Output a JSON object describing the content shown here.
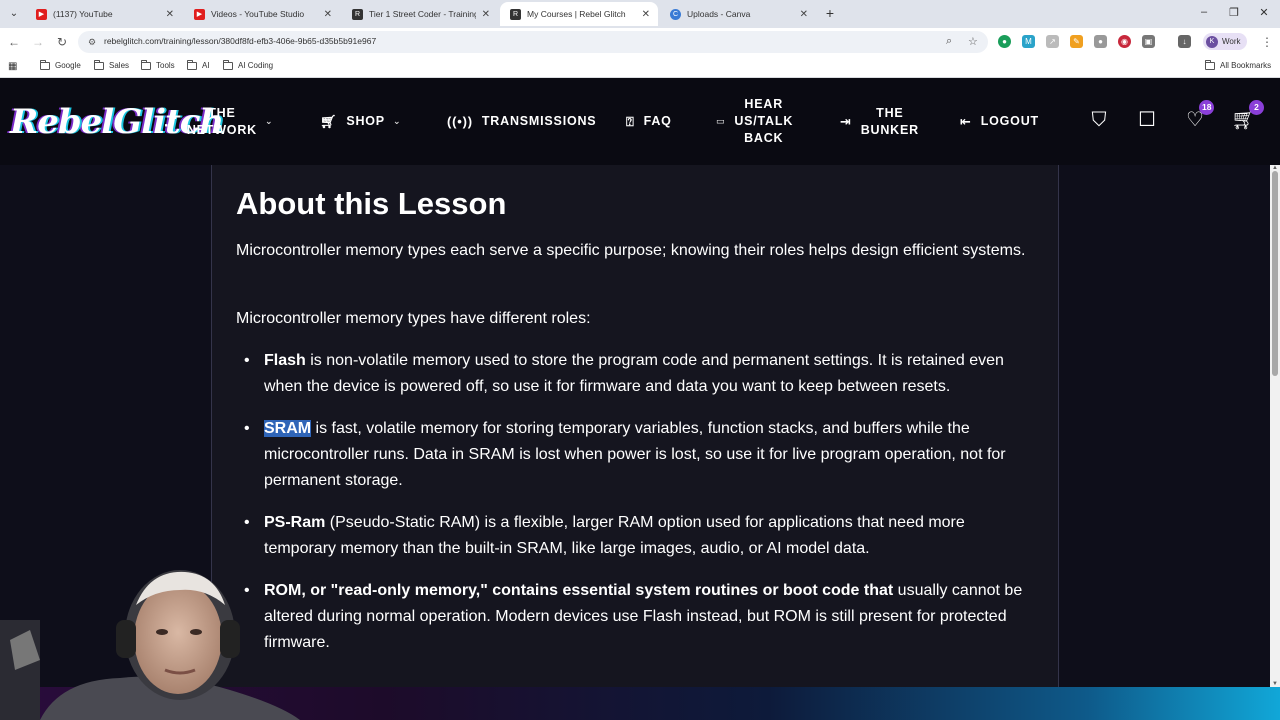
{
  "browser": {
    "tabs": [
      {
        "title": "(1137) YouTube",
        "color": "#e01e1e",
        "active": false
      },
      {
        "title": "Videos - YouTube Studio",
        "color": "#e01e1e",
        "active": false
      },
      {
        "title": "Tier 1 Street Coder - Training A",
        "color": "#333333",
        "active": false
      },
      {
        "title": "My Courses | Rebel Glitch",
        "color": "#333333",
        "active": true
      },
      {
        "title": "Uploads - Canva",
        "color": "#3a7bd5",
        "active": false
      }
    ],
    "url": "rebelglitch.com/training/lesson/380df8fd-efb3-406e-9b65-d35b5b91e967",
    "profile": {
      "initial": "K",
      "label": "Work"
    },
    "bookmarks": [
      "Google",
      "Sales",
      "Tools",
      "AI",
      "AI Coding"
    ],
    "all_bookmarks": "All Bookmarks"
  },
  "site": {
    "logo": "RebelGlitch",
    "nav": {
      "network": [
        "THE",
        "NETWORK"
      ],
      "shop": "SHOP",
      "transmissions": "TRANSMISSIONS",
      "faq": "FAQ",
      "hear_us": [
        "HEAR",
        "US/TALK",
        "BACK"
      ],
      "bunker": [
        "THE",
        "BUNKER"
      ],
      "logout": "LOGOUT"
    },
    "badges": {
      "favorites": "18",
      "cart": "2"
    }
  },
  "lesson": {
    "title": "About this Lesson",
    "intro": "Microcontroller memory types each serve a specific purpose; knowing their roles helps design efficient systems.",
    "lead": "Microcontroller memory types have different roles:",
    "items": [
      {
        "term": "Flash",
        "text": " is non-volatile memory used to store the program code and permanent settings. It is retained even when the device is powered off, so use it for firmware and data you want to keep between resets."
      },
      {
        "term": "SRAM",
        "text": " is fast, volatile memory for storing temporary variables, function stacks, and buffers while the microcontroller runs. Data in SRAM is lost when power is lost, so use it for live program operation, not for permanent storage."
      },
      {
        "term": "PS-Ram",
        "text": " (Pseudo-Static RAM) is a flexible, larger RAM option used for applications that need more temporary memory than the built-in SRAM, like large images, audio, or AI model data."
      },
      {
        "term": "ROM, or \"read-only memory,\" contains essential system routines or boot code that",
        "text": " usually cannot be altered during normal operation. Modern devices use Flash instead, but ROM is still present for protected firmware."
      }
    ]
  },
  "colors": {
    "accent": "#8a3fd8",
    "highlight": "#2f65b8",
    "card_bg": "#15151f",
    "page_bg": "#0e0e1a"
  }
}
